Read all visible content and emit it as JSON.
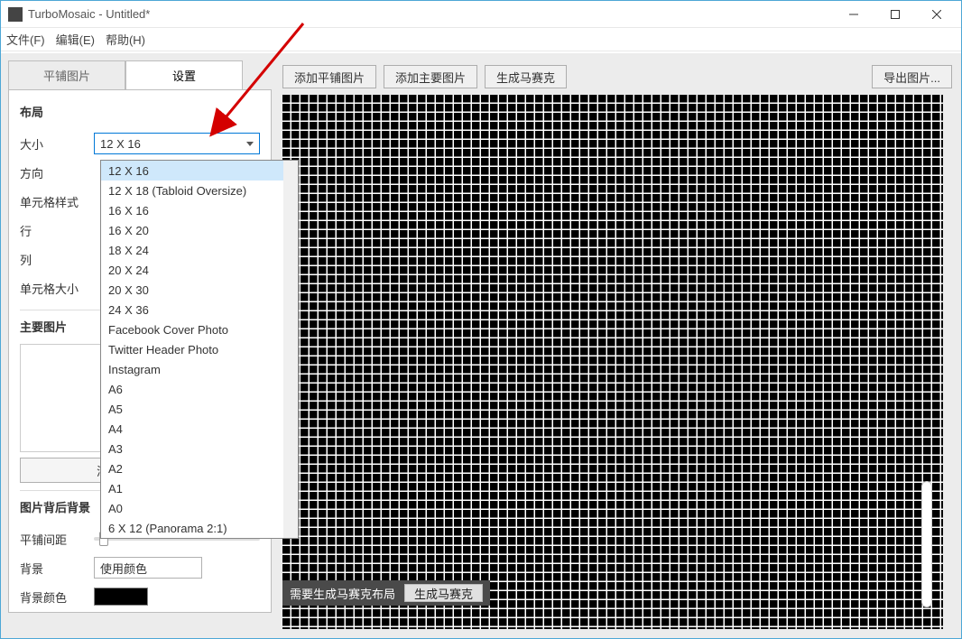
{
  "window": {
    "title": "TurboMosaic - Untitled*"
  },
  "menubar": {
    "file": "文件(F)",
    "edit": "编辑(E)",
    "help": "帮助(H)"
  },
  "tabs": {
    "tiles": "平铺图片",
    "settings": "设置"
  },
  "layout": {
    "heading": "布局",
    "size_label": "大小",
    "size_value": "12 X 16",
    "orientation_label": "方向",
    "cellstyle_label": "单元格样式",
    "rows_label": "行",
    "cols_label": "列",
    "cellsize_label": "单元格大小"
  },
  "mainimg": {
    "heading": "主要图片",
    "add_button": "添加主要图片"
  },
  "background": {
    "heading": "图片背后背景",
    "spacing_label": "平铺间距",
    "bg_label": "背景",
    "bg_mode": "使用颜色",
    "bgcolor_label": "背景颜色"
  },
  "toolbar": {
    "add_tiles": "添加平铺图片",
    "add_main": "添加主要图片",
    "generate": "生成马赛克",
    "export": "导出图片..."
  },
  "status": {
    "msg": "需要生成马赛克布局",
    "btn": "生成马赛克"
  },
  "dropdown": {
    "items": [
      "12 X 16",
      "12 X 18 (Tabloid Oversize)",
      "16 X 16",
      "16 X 20",
      "18 X 24",
      "20 X 24",
      "20 X 30",
      "24 X 36",
      "Facebook Cover Photo",
      "Twitter Header Photo",
      "Instagram",
      "A6",
      "A5",
      "A4",
      "A3",
      "A2",
      "A1",
      "A0",
      "6 X 12 (Panorama 2:1)"
    ],
    "selected_index": 0
  }
}
